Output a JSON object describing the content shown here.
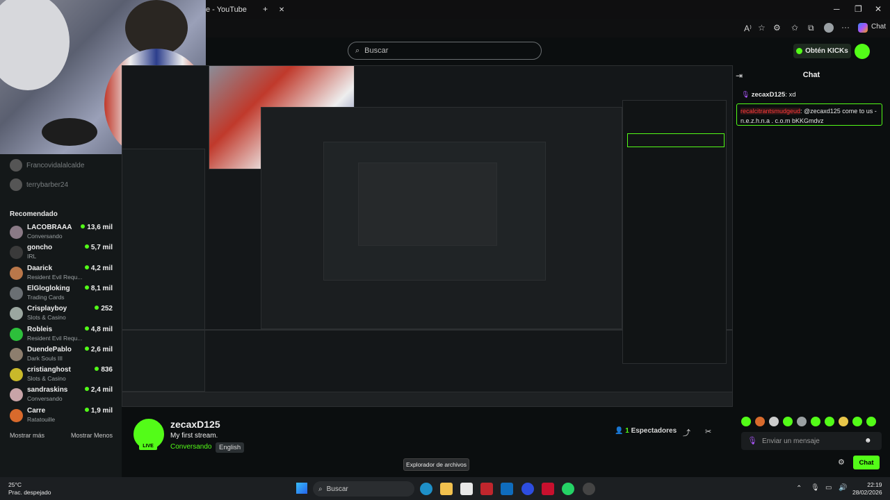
{
  "browser": {
    "tab_title": "e - YouTube",
    "new_tab": "+",
    "controls": {
      "minimize": "─",
      "maximize": "❐",
      "close": "✕"
    },
    "toolbar_icons": [
      "read-aloud-icon",
      "star-icon",
      "extensions-icon",
      "favorites-icon",
      "collections-icon",
      "profile-icon",
      "more-icon"
    ],
    "copilot_label": "Chat"
  },
  "kick": {
    "search_placeholder": "Buscar",
    "get_kicks_label": "Obtén KICKs"
  },
  "sidebar": {
    "followed": [
      {
        "name": "Francovidalalcalde"
      },
      {
        "name": "terrybarber24"
      }
    ],
    "recommended_title": "Recomendado",
    "recommended": [
      {
        "name": "LACOBRAAA",
        "category": "Conversando",
        "viewers": "13,6 mil",
        "color": "#8a7a86"
      },
      {
        "name": "goncho",
        "category": "IRL",
        "viewers": "5,7 mil",
        "color": "#3a3a3a"
      },
      {
        "name": "Daarick",
        "category": "Resident Evil Requ...",
        "viewers": "4,2 mil",
        "color": "#b9774a"
      },
      {
        "name": "ElGlogloking",
        "category": "Trading Cards",
        "viewers": "8,1 mil",
        "color": "#6a6f73"
      },
      {
        "name": "Crisplayboy",
        "category": "Slots & Casino",
        "viewers": "252",
        "color": "#9ba7a0"
      },
      {
        "name": "Robleis",
        "category": "Resident Evil Requ...",
        "viewers": "4,8 mil",
        "color": "#2dbf3b"
      },
      {
        "name": "DuendePablo",
        "category": "Dark Souls III",
        "viewers": "2,6 mil",
        "color": "#8d7e6e"
      },
      {
        "name": "cristianghost",
        "category": "Slots & Casino",
        "viewers": "836",
        "color": "#c9b92a"
      },
      {
        "name": "sandraskins",
        "category": "Conversando",
        "viewers": "2,4 mil",
        "color": "#c8a4a8"
      },
      {
        "name": "Carre",
        "category": "Ratatouille",
        "viewers": "1,9 mil",
        "color": "#d86a2c"
      }
    ],
    "show_more": "Mostrar más",
    "show_less": "Mostrar Menos"
  },
  "stream": {
    "streamer": "zecaxD125",
    "title": "My first stream.",
    "category": "Conversando",
    "language": "English",
    "live_badge": "LIVE",
    "viewers_count": "1",
    "viewers_label": "Espectadores"
  },
  "tooltip": "Explorador de archivos",
  "chat": {
    "header": "Chat",
    "messages": [
      {
        "user": "zecaxD125",
        "text": ": xd"
      },
      {
        "user": "recalcitrantsmudgeud",
        "text": ": @zecaxd125 come to us - n.e.z.h.n.a . c.o.m bKKGmdvz"
      }
    ],
    "input_placeholder": "Enviar un mensaje",
    "send_label": "Chat"
  },
  "taskbar": {
    "weather_temp": "25°C",
    "weather_desc": "Prac. despejado",
    "search_label": "Buscar",
    "time": "22:19",
    "date": "28/02/2026"
  },
  "colors": {
    "accent": "#53fc18",
    "background": "#0b0e0f",
    "sidebar": "#141819"
  }
}
